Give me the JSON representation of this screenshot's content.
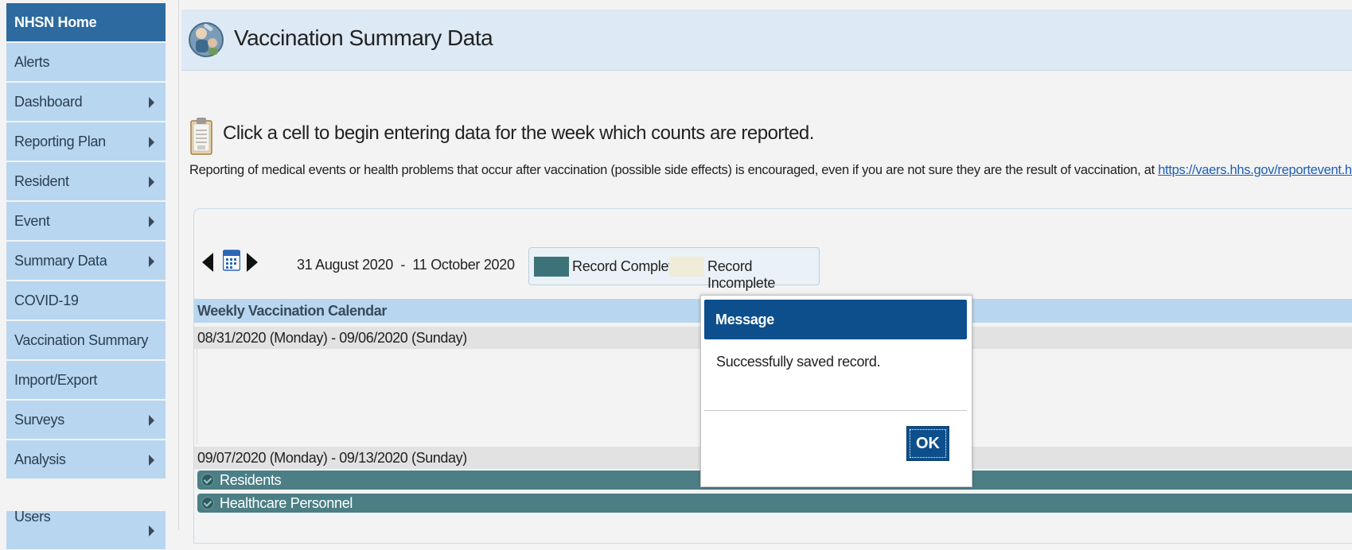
{
  "sidebar": {
    "items": [
      {
        "label": "NHSN Home",
        "active": true,
        "has_submenu": false
      },
      {
        "label": "Alerts",
        "has_submenu": false
      },
      {
        "label": "Dashboard",
        "has_submenu": true
      },
      {
        "label": "Reporting Plan",
        "has_submenu": true
      },
      {
        "label": "Resident",
        "has_submenu": true
      },
      {
        "label": "Event",
        "has_submenu": true
      },
      {
        "label": "Summary Data",
        "has_submenu": true
      },
      {
        "label": "COVID-19",
        "has_submenu": false
      },
      {
        "label": "Vaccination Summary",
        "has_submenu": false
      },
      {
        "label": "Import/Export",
        "has_submenu": false
      },
      {
        "label": "Surveys",
        "has_submenu": true
      },
      {
        "label": "Analysis",
        "has_submenu": true
      },
      {
        "label": "Users",
        "has_submenu": true
      }
    ]
  },
  "header": {
    "title": "Vaccination Summary Data",
    "logo_icon": "nhsn-logo-icon"
  },
  "instructions": {
    "icon": "clipboard-icon",
    "text": "Click a cell to begin entering data for the week which counts are reported.",
    "note_prefix": "Reporting of medical events or health problems that occur after vaccination (possible side effects) is encouraged, even if you are not sure they are the result of vaccination, at ",
    "note_link": "https://vaers.hhs.gov/reportevent.html."
  },
  "calendar": {
    "date_range": "31 August 2020  -  11 October 2020",
    "legend": {
      "complete_label": "Record Complete",
      "incomplete_label": "Record Incomplete",
      "complete_color": "#3c7379",
      "incomplete_color": "#efecd8"
    },
    "header": "Weekly Vaccination Calendar",
    "weeks": [
      {
        "label": "08/31/2020 (Monday) - 09/06/2020 (Sunday)",
        "records": []
      },
      {
        "label": "09/07/2020 (Monday) - 09/13/2020 (Sunday)",
        "records": [
          "Residents",
          "Healthcare Personnel"
        ]
      }
    ]
  },
  "dialog": {
    "title": "Message",
    "message": "Successfully saved record.",
    "ok_label": "OK"
  }
}
